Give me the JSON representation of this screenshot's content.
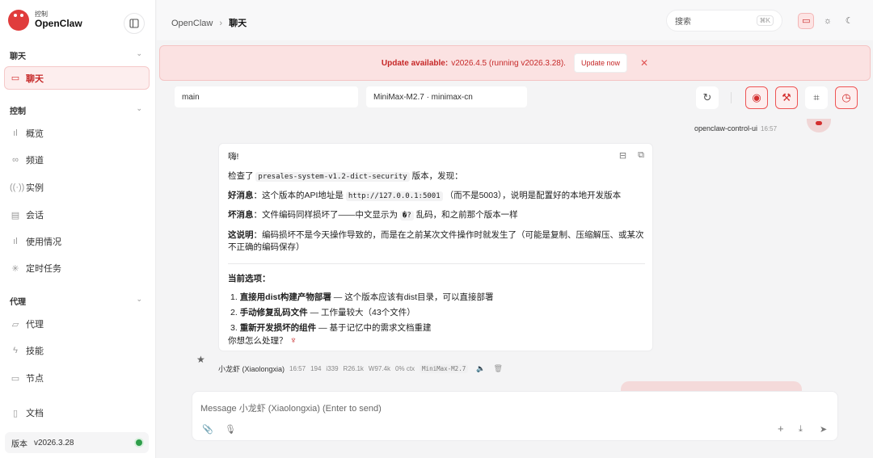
{
  "brand": {
    "subtitle": "控制",
    "name": "OpenClaw"
  },
  "sidebar": {
    "sections": [
      {
        "label": "聊天"
      },
      {
        "label": "控制"
      },
      {
        "label": "代理"
      }
    ],
    "items": [
      {
        "label": "聊天",
        "icon": "chat-icon"
      },
      {
        "label": "概览",
        "icon": "chart-icon"
      },
      {
        "label": "频道",
        "icon": "link-icon"
      },
      {
        "label": "实例",
        "icon": "signal-icon"
      },
      {
        "label": "会话",
        "icon": "document-icon"
      },
      {
        "label": "使用情况",
        "icon": "chart-icon"
      },
      {
        "label": "定时任务",
        "icon": "spinner-icon"
      },
      {
        "label": "代理",
        "icon": "folder-icon"
      },
      {
        "label": "技能",
        "icon": "zap-icon"
      },
      {
        "label": "节点",
        "icon": "monitor-icon"
      },
      {
        "label": "文档",
        "icon": "book-icon"
      }
    ],
    "version_label": "版本",
    "version_value": "v2026.3.28",
    "status_color": "#2e9e4a"
  },
  "header": {
    "breadcrumb_root": "OpenClaw",
    "breadcrumb_sep": "›",
    "breadcrumb_current": "聊天",
    "search_placeholder": "搜索",
    "search_shortcut": "⌘K"
  },
  "banner": {
    "title": "Update available:",
    "text": "v2026.4.5 (running v2026.3.28).",
    "button": "Update now",
    "close": "✕"
  },
  "chat": {
    "session": "main",
    "model": "MiniMax-M2.7 · minimax-cn",
    "top_sender": "openclaw-control-ui",
    "top_time": "16:57",
    "message": {
      "greeting": "嗨!",
      "check_prefix": "检查了",
      "check_code": "presales-system-v1.2-dict-security",
      "check_suffix": "版本，发现：",
      "good_label": "好消息",
      "good_prefix": "：这个版本的API地址是",
      "good_code": "http://127.0.0.1:5001",
      "good_suffix": "（而不是5003），说明是配置好的本地开发版本",
      "bad_label": "坏消息",
      "bad_prefix": "：文件编码同样损坏了——中文显示为",
      "bad_code": "�?",
      "bad_suffix": "乱码，和之前那个版本一样",
      "explain_label": "这说明",
      "explain_text": "：编码损坏不是今天操作导致的，而是在之前某次文件操作时就发生了（可能是复制、压缩解压、或某次不正确的编码保存）",
      "options_title": "当前选项：",
      "options": [
        {
          "num": "1.",
          "bold": "直接用dist构建产物部署",
          "rest": " — 这个版本应该有dist目录，可以直接部署"
        },
        {
          "num": "2.",
          "bold": "手动修复乱码文件",
          "rest": " — 工作量较大（43个文件）"
        },
        {
          "num": "3.",
          "bold": "重新开发损坏的组件",
          "rest": " — 基于记忆中的需求文档重建"
        }
      ],
      "question": "你想怎么处理？"
    },
    "meta": {
      "sender": "小龙虾 (Xiaolongxia)",
      "time": "16:57",
      "tokens_total": "194",
      "tokens_in": "i339",
      "tokens_read": "R26.1k",
      "tokens_write": "W97.4k",
      "ctx": "0% ctx",
      "model": "MiniMax-M2.7"
    },
    "composer_placeholder": "Message 小龙虾 (Xiaolongxia) (Enter to send)"
  },
  "colors": {
    "accent": "#d32f2f",
    "banner_bg": "#fbe2e2"
  }
}
